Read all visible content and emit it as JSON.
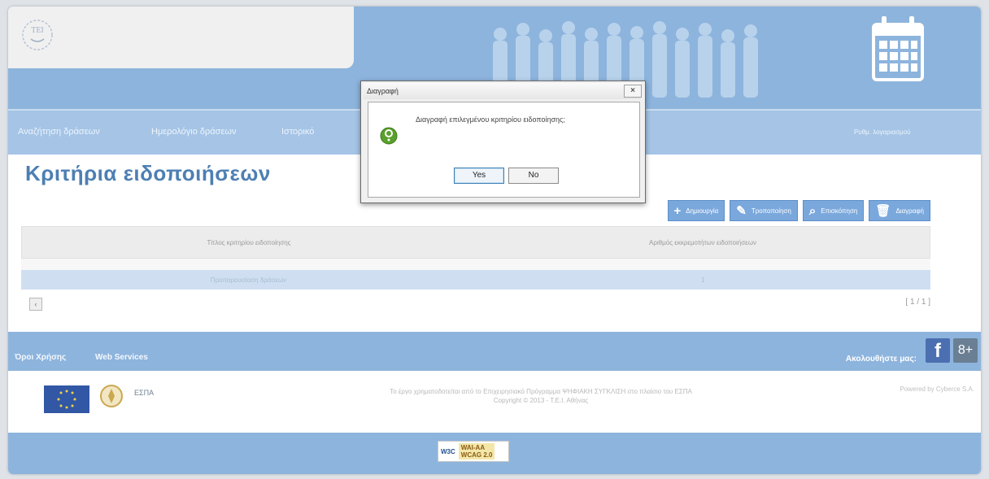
{
  "nav": {
    "items": [
      "Αναζήτηση δράσεων",
      "Ημερολόγιο δράσεων",
      "Ιστορικό"
    ],
    "user": "Ρυθμ. λογαριασμού"
  },
  "page": {
    "title": "Κριτήρια ειδοποιήσεων"
  },
  "toolbar": {
    "create": "Δημιουργία",
    "edit": "Τροποποίηση",
    "view": "Επισκόπηση",
    "delete": "Διαγραφή"
  },
  "table": {
    "columns": [
      "Τίτλος κριτηρίου ειδοποίησης",
      "Αριθμός εκκρεμοτήτων ειδοποιήσεων"
    ],
    "rows": [
      [
        "Προπαρουσίαση δράσεων",
        "1"
      ]
    ],
    "page_indicator": "[ 1 / 1 ]"
  },
  "footer": {
    "terms": "Όροι Χρήσης",
    "services": "Web Services",
    "follow": "Ακολουθήστε μας:",
    "credit_line1": "Το έργο χρηματοδοτείται από το Επιχειρησιακό Πρόγραμμα ΨΗΦΙΑΚΗ ΣΥΓΚΛΙΣΗ στο πλαίσιο του ΕΣΠΑ",
    "credit_line2": "Copyright © 2013 - Τ.Ε.Ι. Αθήνας",
    "powered_by": "Powered by Cyberce S.A.",
    "espa_label": "ΕΣΠΑ",
    "wcag_w3c": "W3C",
    "wcag_level": "WAI-AA",
    "wcag_version": "WCAG 2.0"
  },
  "dialog": {
    "title": "Διαγραφή",
    "message": "Διαγραφή επιλεγμένου κριτηρίου ειδοποίησης;",
    "yes": "Yes",
    "no": "No",
    "close": "×"
  },
  "colors": {
    "header": "#8db4dd",
    "title": "#4d7fb3",
    "button": "#7aa8dc"
  }
}
